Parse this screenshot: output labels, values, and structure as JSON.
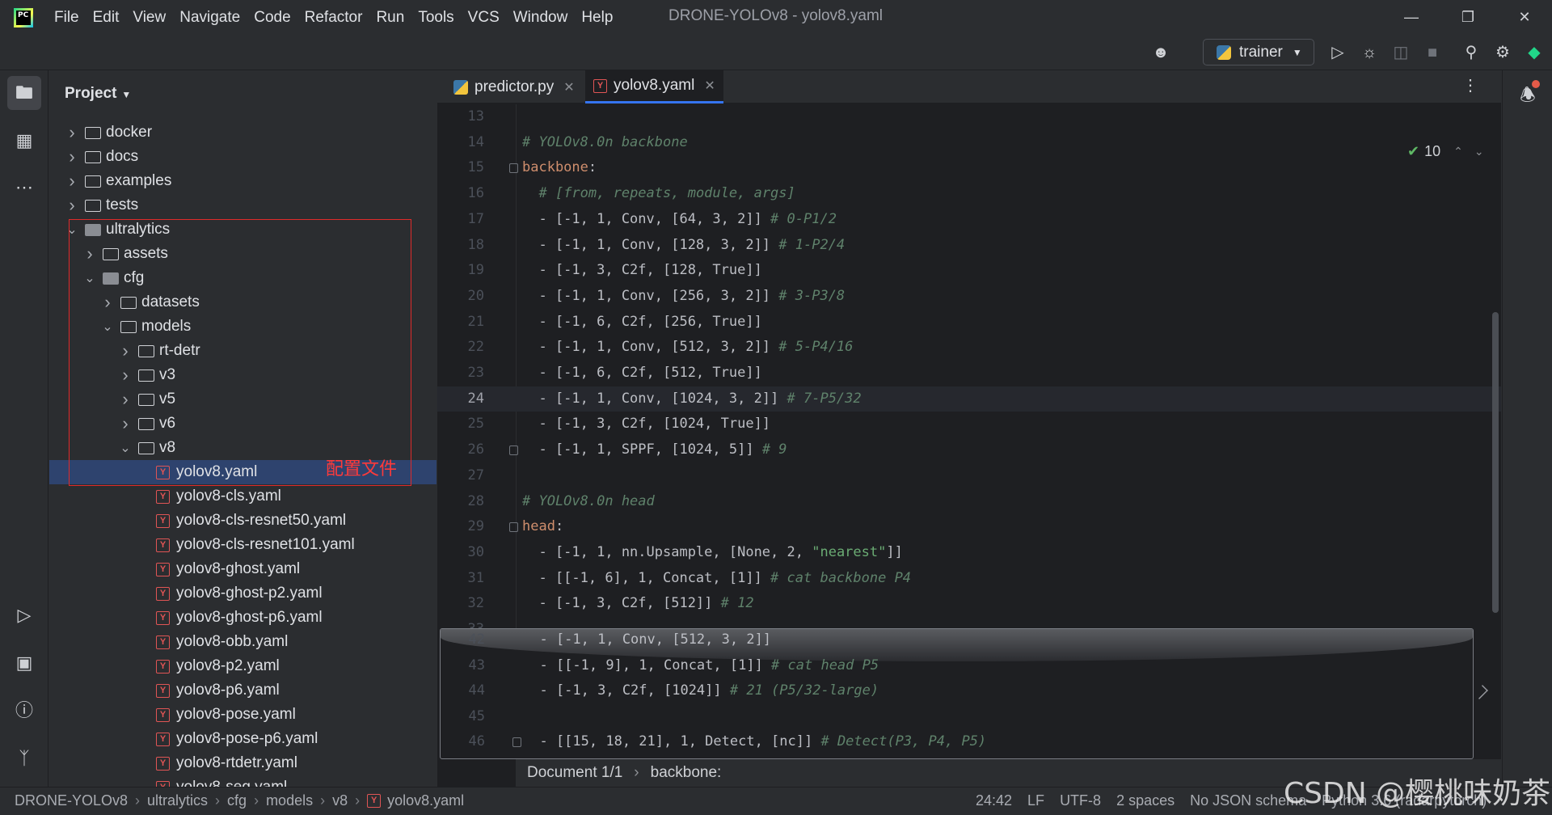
{
  "app": {
    "window_title": "DRONE-YOLOv8 - yolov8.yaml",
    "logo_text": "PC",
    "menu": [
      "File",
      "Edit",
      "View",
      "Navigate",
      "Code",
      "Refactor",
      "Run",
      "Tools",
      "VCS",
      "Window",
      "Help"
    ]
  },
  "toolbar": {
    "run_config": "trainer"
  },
  "project": {
    "header": "Project",
    "tree": [
      {
        "label": "docker",
        "type": "folder",
        "depth": 0,
        "expanded": false
      },
      {
        "label": "docs",
        "type": "folder",
        "depth": 0,
        "expanded": false
      },
      {
        "label": "examples",
        "type": "folder",
        "depth": 0,
        "expanded": false
      },
      {
        "label": "tests",
        "type": "folder",
        "depth": 0,
        "expanded": false
      },
      {
        "label": "ultralytics",
        "type": "package",
        "depth": 0,
        "expanded": true
      },
      {
        "label": "assets",
        "type": "folder",
        "depth": 1,
        "expanded": false
      },
      {
        "label": "cfg",
        "type": "package",
        "depth": 1,
        "expanded": true
      },
      {
        "label": "datasets",
        "type": "folder",
        "depth": 2,
        "expanded": false
      },
      {
        "label": "models",
        "type": "folder",
        "depth": 2,
        "expanded": true
      },
      {
        "label": "rt-detr",
        "type": "folder",
        "depth": 3,
        "expanded": false
      },
      {
        "label": "v3",
        "type": "folder",
        "depth": 3,
        "expanded": false
      },
      {
        "label": "v5",
        "type": "folder",
        "depth": 3,
        "expanded": false
      },
      {
        "label": "v6",
        "type": "folder",
        "depth": 3,
        "expanded": false
      },
      {
        "label": "v8",
        "type": "folder",
        "depth": 3,
        "expanded": true
      },
      {
        "label": "yolov8.yaml",
        "type": "yaml",
        "depth": 4,
        "selected": true
      },
      {
        "label": "yolov8-cls.yaml",
        "type": "yaml",
        "depth": 4
      },
      {
        "label": "yolov8-cls-resnet50.yaml",
        "type": "yaml",
        "depth": 4
      },
      {
        "label": "yolov8-cls-resnet101.yaml",
        "type": "yaml",
        "depth": 4
      },
      {
        "label": "yolov8-ghost.yaml",
        "type": "yaml",
        "depth": 4
      },
      {
        "label": "yolov8-ghost-p2.yaml",
        "type": "yaml",
        "depth": 4
      },
      {
        "label": "yolov8-ghost-p6.yaml",
        "type": "yaml",
        "depth": 4
      },
      {
        "label": "yolov8-obb.yaml",
        "type": "yaml",
        "depth": 4
      },
      {
        "label": "yolov8-p2.yaml",
        "type": "yaml",
        "depth": 4
      },
      {
        "label": "yolov8-p6.yaml",
        "type": "yaml",
        "depth": 4
      },
      {
        "label": "yolov8-pose.yaml",
        "type": "yaml",
        "depth": 4
      },
      {
        "label": "yolov8-pose-p6.yaml",
        "type": "yaml",
        "depth": 4
      },
      {
        "label": "yolov8-rtdetr.yaml",
        "type": "yaml",
        "depth": 4
      },
      {
        "label": "yolov8-seg.yaml",
        "type": "yaml",
        "depth": 4
      }
    ],
    "annotation": "配置文件"
  },
  "tabs": [
    {
      "label": "predictor.py",
      "active": false
    },
    {
      "label": "yolov8.yaml",
      "active": true
    }
  ],
  "inspections": {
    "count": "10"
  },
  "code": [
    {
      "n": "13",
      "parts": []
    },
    {
      "n": "14",
      "parts": [
        {
          "t": "# YOLOv8.0n backbone",
          "c": "comment"
        }
      ]
    },
    {
      "n": "15",
      "fold": true,
      "parts": [
        {
          "t": "backbone",
          "c": "key"
        },
        {
          "t": ":",
          "c": ""
        }
      ]
    },
    {
      "n": "16",
      "parts": [
        {
          "t": "  ",
          "c": ""
        },
        {
          "t": "# [from, repeats, module, args]",
          "c": "comment"
        }
      ]
    },
    {
      "n": "17",
      "parts": [
        {
          "t": "  - [-1, 1, Conv, [64, 3, 2]] ",
          "c": ""
        },
        {
          "t": "# 0-P1/2",
          "c": "comment"
        }
      ]
    },
    {
      "n": "18",
      "parts": [
        {
          "t": "  - [-1, 1, Conv, [128, 3, 2]] ",
          "c": ""
        },
        {
          "t": "# 1-P2/4",
          "c": "comment"
        }
      ]
    },
    {
      "n": "19",
      "parts": [
        {
          "t": "  - [-1, 3, C2f, [128, True]]",
          "c": ""
        }
      ]
    },
    {
      "n": "20",
      "parts": [
        {
          "t": "  - [-1, 1, Conv, [256, 3, 2]] ",
          "c": ""
        },
        {
          "t": "# 3-P3/8",
          "c": "comment"
        }
      ]
    },
    {
      "n": "21",
      "parts": [
        {
          "t": "  - [-1, 6, C2f, [256, True]]",
          "c": ""
        }
      ]
    },
    {
      "n": "22",
      "parts": [
        {
          "t": "  - [-1, 1, Conv, [512, 3, 2]] ",
          "c": ""
        },
        {
          "t": "# 5-P4/16",
          "c": "comment"
        }
      ]
    },
    {
      "n": "23",
      "parts": [
        {
          "t": "  - [-1, 6, C2f, [512, True]]",
          "c": ""
        }
      ]
    },
    {
      "n": "24",
      "current": true,
      "parts": [
        {
          "t": "  - [-1, 1, Conv, [1024, 3, 2]] ",
          "c": ""
        },
        {
          "t": "# 7-P5/32",
          "c": "comment"
        }
      ]
    },
    {
      "n": "25",
      "parts": [
        {
          "t": "  - [-1, 3, C2f, [1024, True]]",
          "c": ""
        }
      ]
    },
    {
      "n": "26",
      "fold": true,
      "parts": [
        {
          "t": "  - [-1, 1, SPPF, [1024, 5]] ",
          "c": ""
        },
        {
          "t": "# 9",
          "c": "comment"
        }
      ]
    },
    {
      "n": "27",
      "parts": []
    },
    {
      "n": "28",
      "parts": [
        {
          "t": "# YOLOv8.0n head",
          "c": "comment"
        }
      ]
    },
    {
      "n": "29",
      "fold": true,
      "parts": [
        {
          "t": "head",
          "c": "key"
        },
        {
          "t": ":",
          "c": ""
        }
      ]
    },
    {
      "n": "30",
      "parts": [
        {
          "t": "  - [-1, 1, nn.Upsample, [None, 2, ",
          "c": ""
        },
        {
          "t": "\"nearest\"",
          "c": "str"
        },
        {
          "t": "]]",
          "c": ""
        }
      ]
    },
    {
      "n": "31",
      "parts": [
        {
          "t": "  - [[-1, 6], 1, Concat, [1]] ",
          "c": ""
        },
        {
          "t": "# cat backbone P4",
          "c": "comment"
        }
      ]
    },
    {
      "n": "32",
      "parts": [
        {
          "t": "  - [-1, 3, C2f, [512]] ",
          "c": ""
        },
        {
          "t": "# 12",
          "c": "comment"
        }
      ]
    },
    {
      "n": "33",
      "parts": []
    }
  ],
  "preview_code": [
    {
      "n": "42",
      "parts": [
        {
          "t": "  - [-1, 1, Conv, [512, 3, 2]]",
          "c": ""
        }
      ]
    },
    {
      "n": "43",
      "parts": [
        {
          "t": "  - [[-1, 9], 1, Concat, [1]] ",
          "c": ""
        },
        {
          "t": "# cat head P5",
          "c": "comment"
        }
      ]
    },
    {
      "n": "44",
      "parts": [
        {
          "t": "  - [-1, 3, C2f, [1024]] ",
          "c": ""
        },
        {
          "t": "# 21 (P5/32-large)",
          "c": "comment"
        }
      ]
    },
    {
      "n": "45",
      "parts": []
    },
    {
      "n": "46",
      "fold": true,
      "parts": [
        {
          "t": "  - [[15, 18, 21], 1, Detect, [nc]] ",
          "c": ""
        },
        {
          "t": "# Detect(P3, P4, P5)",
          "c": "comment"
        }
      ]
    }
  ],
  "editor_breadcrumb": [
    "Document 1/1",
    "backbone:"
  ],
  "status": {
    "path": [
      "DRONE-YOLOv8",
      "ultralytics",
      "cfg",
      "models",
      "v8",
      "yolov8.yaml"
    ],
    "position": "24:42",
    "line_sep": "LF",
    "encoding": "UTF-8",
    "indent": "2 spaces",
    "schema": "No JSON schema",
    "interpreter": "Python 3.6 (radarpytorch)"
  },
  "watermark": "CSDN @樱桃味奶茶"
}
